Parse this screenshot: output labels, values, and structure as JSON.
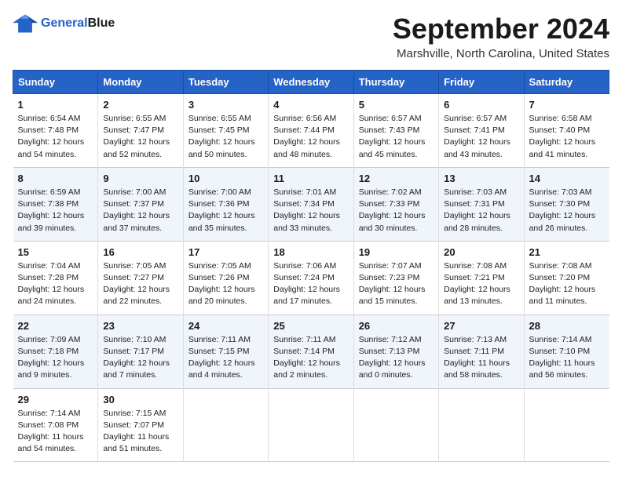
{
  "header": {
    "logo_general": "General",
    "logo_blue": "Blue",
    "title": "September 2024",
    "subtitle": "Marshville, North Carolina, United States"
  },
  "weekdays": [
    "Sunday",
    "Monday",
    "Tuesday",
    "Wednesday",
    "Thursday",
    "Friday",
    "Saturday"
  ],
  "weeks": [
    [
      {
        "day": "1",
        "info": "Sunrise: 6:54 AM\nSunset: 7:48 PM\nDaylight: 12 hours\nand 54 minutes."
      },
      {
        "day": "2",
        "info": "Sunrise: 6:55 AM\nSunset: 7:47 PM\nDaylight: 12 hours\nand 52 minutes."
      },
      {
        "day": "3",
        "info": "Sunrise: 6:55 AM\nSunset: 7:45 PM\nDaylight: 12 hours\nand 50 minutes."
      },
      {
        "day": "4",
        "info": "Sunrise: 6:56 AM\nSunset: 7:44 PM\nDaylight: 12 hours\nand 48 minutes."
      },
      {
        "day": "5",
        "info": "Sunrise: 6:57 AM\nSunset: 7:43 PM\nDaylight: 12 hours\nand 45 minutes."
      },
      {
        "day": "6",
        "info": "Sunrise: 6:57 AM\nSunset: 7:41 PM\nDaylight: 12 hours\nand 43 minutes."
      },
      {
        "day": "7",
        "info": "Sunrise: 6:58 AM\nSunset: 7:40 PM\nDaylight: 12 hours\nand 41 minutes."
      }
    ],
    [
      {
        "day": "8",
        "info": "Sunrise: 6:59 AM\nSunset: 7:38 PM\nDaylight: 12 hours\nand 39 minutes."
      },
      {
        "day": "9",
        "info": "Sunrise: 7:00 AM\nSunset: 7:37 PM\nDaylight: 12 hours\nand 37 minutes."
      },
      {
        "day": "10",
        "info": "Sunrise: 7:00 AM\nSunset: 7:36 PM\nDaylight: 12 hours\nand 35 minutes."
      },
      {
        "day": "11",
        "info": "Sunrise: 7:01 AM\nSunset: 7:34 PM\nDaylight: 12 hours\nand 33 minutes."
      },
      {
        "day": "12",
        "info": "Sunrise: 7:02 AM\nSunset: 7:33 PM\nDaylight: 12 hours\nand 30 minutes."
      },
      {
        "day": "13",
        "info": "Sunrise: 7:03 AM\nSunset: 7:31 PM\nDaylight: 12 hours\nand 28 minutes."
      },
      {
        "day": "14",
        "info": "Sunrise: 7:03 AM\nSunset: 7:30 PM\nDaylight: 12 hours\nand 26 minutes."
      }
    ],
    [
      {
        "day": "15",
        "info": "Sunrise: 7:04 AM\nSunset: 7:28 PM\nDaylight: 12 hours\nand 24 minutes."
      },
      {
        "day": "16",
        "info": "Sunrise: 7:05 AM\nSunset: 7:27 PM\nDaylight: 12 hours\nand 22 minutes."
      },
      {
        "day": "17",
        "info": "Sunrise: 7:05 AM\nSunset: 7:26 PM\nDaylight: 12 hours\nand 20 minutes."
      },
      {
        "day": "18",
        "info": "Sunrise: 7:06 AM\nSunset: 7:24 PM\nDaylight: 12 hours\nand 17 minutes."
      },
      {
        "day": "19",
        "info": "Sunrise: 7:07 AM\nSunset: 7:23 PM\nDaylight: 12 hours\nand 15 minutes."
      },
      {
        "day": "20",
        "info": "Sunrise: 7:08 AM\nSunset: 7:21 PM\nDaylight: 12 hours\nand 13 minutes."
      },
      {
        "day": "21",
        "info": "Sunrise: 7:08 AM\nSunset: 7:20 PM\nDaylight: 12 hours\nand 11 minutes."
      }
    ],
    [
      {
        "day": "22",
        "info": "Sunrise: 7:09 AM\nSunset: 7:18 PM\nDaylight: 12 hours\nand 9 minutes."
      },
      {
        "day": "23",
        "info": "Sunrise: 7:10 AM\nSunset: 7:17 PM\nDaylight: 12 hours\nand 7 minutes."
      },
      {
        "day": "24",
        "info": "Sunrise: 7:11 AM\nSunset: 7:15 PM\nDaylight: 12 hours\nand 4 minutes."
      },
      {
        "day": "25",
        "info": "Sunrise: 7:11 AM\nSunset: 7:14 PM\nDaylight: 12 hours\nand 2 minutes."
      },
      {
        "day": "26",
        "info": "Sunrise: 7:12 AM\nSunset: 7:13 PM\nDaylight: 12 hours\nand 0 minutes."
      },
      {
        "day": "27",
        "info": "Sunrise: 7:13 AM\nSunset: 7:11 PM\nDaylight: 11 hours\nand 58 minutes."
      },
      {
        "day": "28",
        "info": "Sunrise: 7:14 AM\nSunset: 7:10 PM\nDaylight: 11 hours\nand 56 minutes."
      }
    ],
    [
      {
        "day": "29",
        "info": "Sunrise: 7:14 AM\nSunset: 7:08 PM\nDaylight: 11 hours\nand 54 minutes."
      },
      {
        "day": "30",
        "info": "Sunrise: 7:15 AM\nSunset: 7:07 PM\nDaylight: 11 hours\nand 51 minutes."
      },
      null,
      null,
      null,
      null,
      null
    ]
  ]
}
